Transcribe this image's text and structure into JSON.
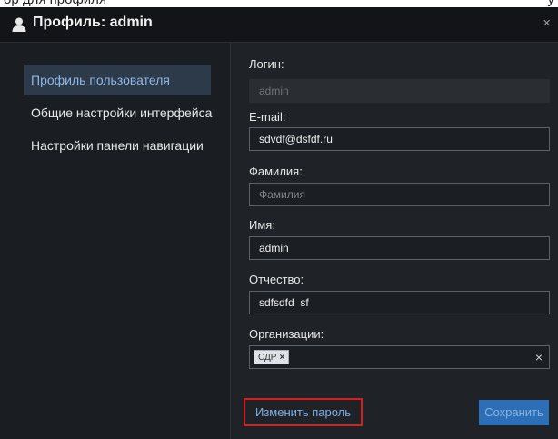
{
  "page_top_fragment": {
    "left": "ор для профиля",
    "right": "у"
  },
  "dialog": {
    "title": "Профиль: admin",
    "close_glyph": "×"
  },
  "sidebar": {
    "items": [
      {
        "label": "Профиль пользователя",
        "active": true
      },
      {
        "label": "Общие настройки интерфейса",
        "active": false
      },
      {
        "label": "Настройки панели навигации",
        "active": false
      }
    ]
  },
  "form": {
    "login": {
      "label": "Логин:",
      "value": "admin",
      "disabled": true
    },
    "email": {
      "label": "E-mail:",
      "value": "sdvdf@dsfdf.ru"
    },
    "lastname": {
      "label": "Фамилия:",
      "value": "",
      "placeholder": "Фамилия"
    },
    "firstname": {
      "label": "Имя:",
      "value": "admin"
    },
    "patronymic": {
      "label": "Отчество:",
      "value": "sdfsdfd  sf"
    },
    "organizations": {
      "label": "Организации:",
      "tags": [
        {
          "text": "СДР",
          "remove_glyph": "×"
        }
      ],
      "clear_glyph": "×"
    }
  },
  "buttons": {
    "change_password": "Изменить пароль",
    "save": "Сохранить"
  },
  "colors": {
    "title_bar": "#121417",
    "panel": "#1f2327",
    "active_item_bg": "#2c3a4a",
    "active_item_text": "#8fb8e8",
    "highlight_border": "#d91e1e",
    "primary_button": "#2d6fb6"
  }
}
